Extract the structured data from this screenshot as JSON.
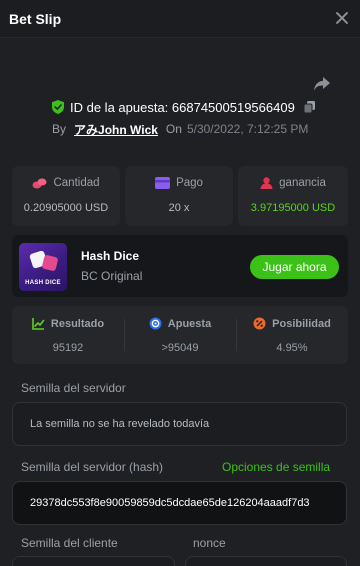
{
  "header": {
    "title": "Bet Slip"
  },
  "bet": {
    "id_label": "ID de la apuesta: 66874500519566409",
    "by_label": "By",
    "user": "アみJohn Wick",
    "on_label": "On",
    "datetime": "5/30/2022, 7:12:25 PM"
  },
  "stats": {
    "amount": {
      "label": "Cantidad",
      "value": "0.20905000 USD"
    },
    "payout": {
      "label": "Pago",
      "value": "20 x"
    },
    "profit": {
      "label": "ganancia",
      "value": "3.97195000 USD"
    }
  },
  "game": {
    "name": "Hash Dice",
    "provider": "BC Original",
    "thumb_text": "HASH DICE",
    "play_label": "Jugar ahora"
  },
  "results": {
    "result": {
      "label": "Resultado",
      "value": "95192"
    },
    "bet": {
      "label": "Apuesta",
      "value": ">95049"
    },
    "chance": {
      "label": "Posibilidad",
      "value": "4.95%"
    }
  },
  "seeds": {
    "server_label": "Semilla del servidor",
    "server_value": "La semilla no se ha revelado todavía",
    "server_hash_label": "Semilla del servidor (hash)",
    "seed_options_label": "Opciones de semilla",
    "server_hash_value": "29378dc553f8e90059859dc5dcdae65de126204aaadf7d3",
    "client_label": "Semilla del cliente",
    "nonce_label": "nonce"
  },
  "colors": {
    "accent_green": "#3bc117",
    "profit_green": "#5ed31d",
    "background": "#1e2024",
    "card": "#25272b"
  },
  "icons": {
    "close": "close-icon",
    "share": "share-icon",
    "shield": "shield-check-icon",
    "copy": "copy-icon",
    "amount": "coins-icon",
    "payout": "wallet-icon",
    "profit": "profit-icon",
    "result": "chart-up-icon",
    "bet": "target-icon",
    "chance": "percent-icon"
  }
}
